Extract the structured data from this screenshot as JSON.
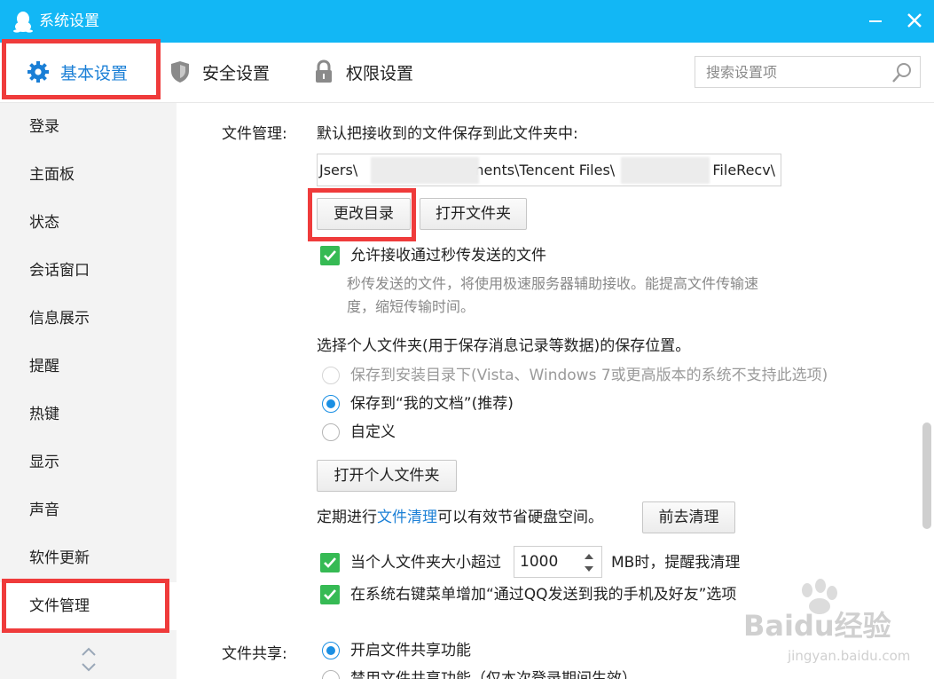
{
  "window": {
    "title": "系统设置"
  },
  "tabs": {
    "basic": "基本设置",
    "security": "安全设置",
    "permission": "权限设置"
  },
  "search": {
    "placeholder": "搜索设置项"
  },
  "sidebar": {
    "items": [
      {
        "label": "登录"
      },
      {
        "label": "主面板"
      },
      {
        "label": "状态"
      },
      {
        "label": "会话窗口"
      },
      {
        "label": "信息展示"
      },
      {
        "label": "提醒"
      },
      {
        "label": "热键"
      },
      {
        "label": "显示"
      },
      {
        "label": "声音"
      },
      {
        "label": "软件更新"
      },
      {
        "label": "文件管理"
      }
    ],
    "active_item": "文件管理"
  },
  "file_management": {
    "section_label": "文件管理:",
    "default_folder_text": "默认把接收到的文件保存到此文件夹中:",
    "path_prefix": "Jsers\\",
    "path_mid1": "nents\\Tencent Files\\",
    "path_suffix": "FileRecv\\",
    "change_dir_button": "更改目录",
    "open_folder_button": "打开文件夹",
    "allow_instant": {
      "checked": true,
      "label": "允许接收通过秒传发送的文件",
      "desc_line1": "秒传发送的文件，将使用极速服务器辅助接收。能提高文件传输速",
      "desc_line2": "度，缩短传输时间。"
    },
    "personal_folder_text": "选择个人文件夹(用于保存消息记录等数据)的保存位置。",
    "radio_options": [
      {
        "label": "保存到安装目录下(Vista、Windows 7或更高版本的系统不支持此选项)",
        "state": "disabled"
      },
      {
        "label": "保存到“我的文档”(推荐)",
        "state": "selected"
      },
      {
        "label": "自定义",
        "state": "unselected"
      }
    ],
    "open_personal_button": "打开个人文件夹",
    "cleanup_prefix": "定期进行",
    "cleanup_link": "文件清理",
    "cleanup_suffix": "可以有效节省硬盘空间。",
    "cleanup_button": "前去清理",
    "size_alert": {
      "checked": true,
      "label_before": "当个人文件夹大小超过",
      "value": "1000",
      "label_after": "MB时，提醒我清理"
    },
    "context_menu": {
      "checked": true,
      "label": "在系统右键菜单增加“通过QQ发送到我的手机及好友”选项"
    }
  },
  "file_sharing": {
    "section_label": "文件共享:",
    "enable_label": "开启文件共享功能",
    "enable_selected": true,
    "disable_label": "禁用文件共享功能（仅本次登录期间生效）"
  },
  "watermark": {
    "brand": "Baidu经验",
    "url": "jingyan.baidu.com"
  },
  "colors": {
    "titlebar": "#12b7f5",
    "accent": "#1a7fd6",
    "highlight": "#ef3b3b",
    "check": "#36ba54"
  }
}
